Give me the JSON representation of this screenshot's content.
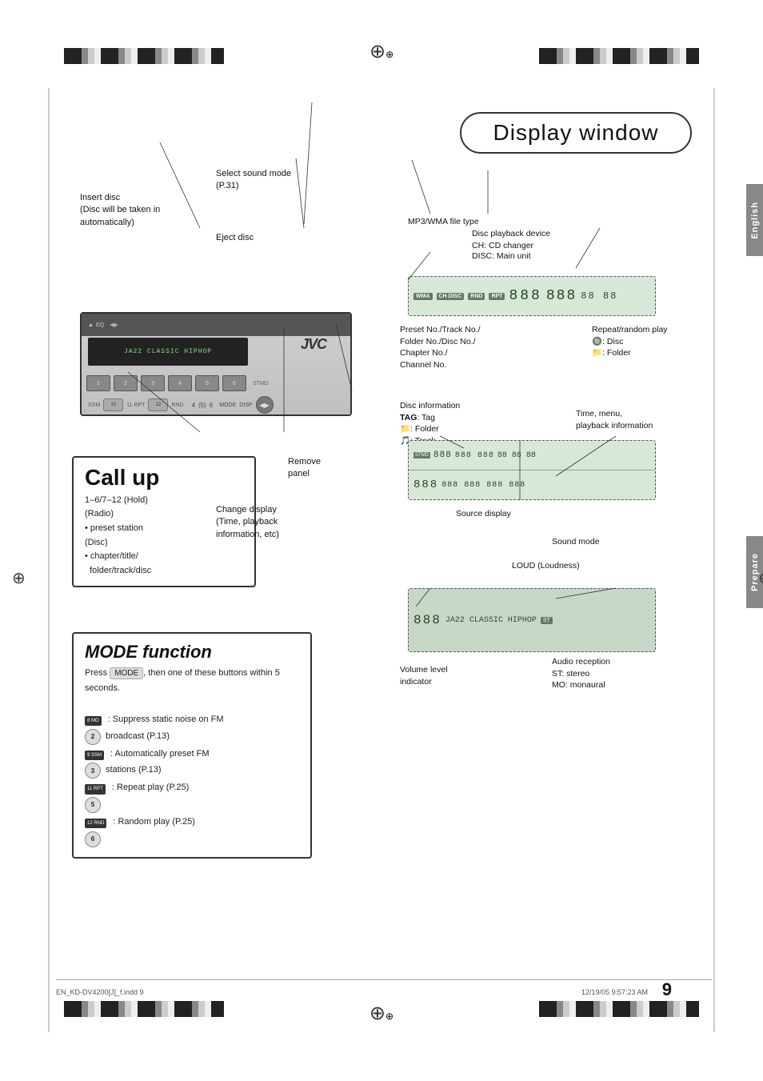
{
  "page": {
    "title": "Display window",
    "page_number": "9",
    "footer_left": "EN_KD-DV4200[J]_f.indd   9",
    "footer_right": "12/19/05   9:57:23 AM"
  },
  "side_tabs": {
    "english": "English",
    "prepare": "Prepare"
  },
  "left_annotations": {
    "select_sound_mode": "Select sound mode\n(P.31)",
    "insert_disc": "Insert disc\n(Disc will be taken in\nautomatically)",
    "eject_disc": "Eject disc",
    "callup_title": "Call up",
    "callup_line1": "1–6/7–12 (Hold)",
    "callup_radio_label": "(Radio)",
    "callup_radio_detail": "• preset station",
    "callup_disc_label": "(Disc)",
    "callup_disc_detail": "• chapter/title/\n  folder/track/disc",
    "remove_panel": "Remove\npanel",
    "change_display": "Change display\n(Time, playback\ninformation, etc)"
  },
  "mode_function": {
    "title": "MODE function",
    "intro": "Press      MODE     , then one of these\nbuttons within 5 seconds.",
    "items": [
      {
        "badge": "8 MO",
        "btn": "2",
        "text": ": Suppress static noise on FM\n  broadcast (P.13)"
      },
      {
        "badge": "9 SSM",
        "btn": "3",
        "text": ": Automatically preset FM\n  stations (P.13)"
      },
      {
        "badge": "11 RPT",
        "btn": "5",
        "text": ": Repeat play (P.25)"
      },
      {
        "badge": "12 RND",
        "btn": "6",
        "text": ": Random play (P.25)"
      }
    ]
  },
  "right_annotations": {
    "mp3_wma": "MP3/WMA file type",
    "disc_playback": "Disc playback device",
    "ch_cd": "CH: CD changer",
    "disc_main": "DISC: Main unit",
    "preset_no": "Preset No./Track No./\nFolder No./Disc No./\nChapter No./\nChannel No.",
    "repeat_random": "Repeat/random play",
    "disc_icon": "🔘: Disc",
    "folder_icon": "📁: Folder",
    "disc_info_label": "Disc information",
    "tag_label": "TAG: Tag",
    "folder_label": "📁: Folder",
    "track_label": "🎵: Track",
    "time_menu": "Time, menu,\nplayback information",
    "source_display": "Source display",
    "sound_mode": "Sound mode",
    "loud": "LOUD (Loudness)",
    "volume_level": "Volume level\nindicator",
    "audio_reception": "Audio reception\nST: stereo\nMO: monaural"
  }
}
